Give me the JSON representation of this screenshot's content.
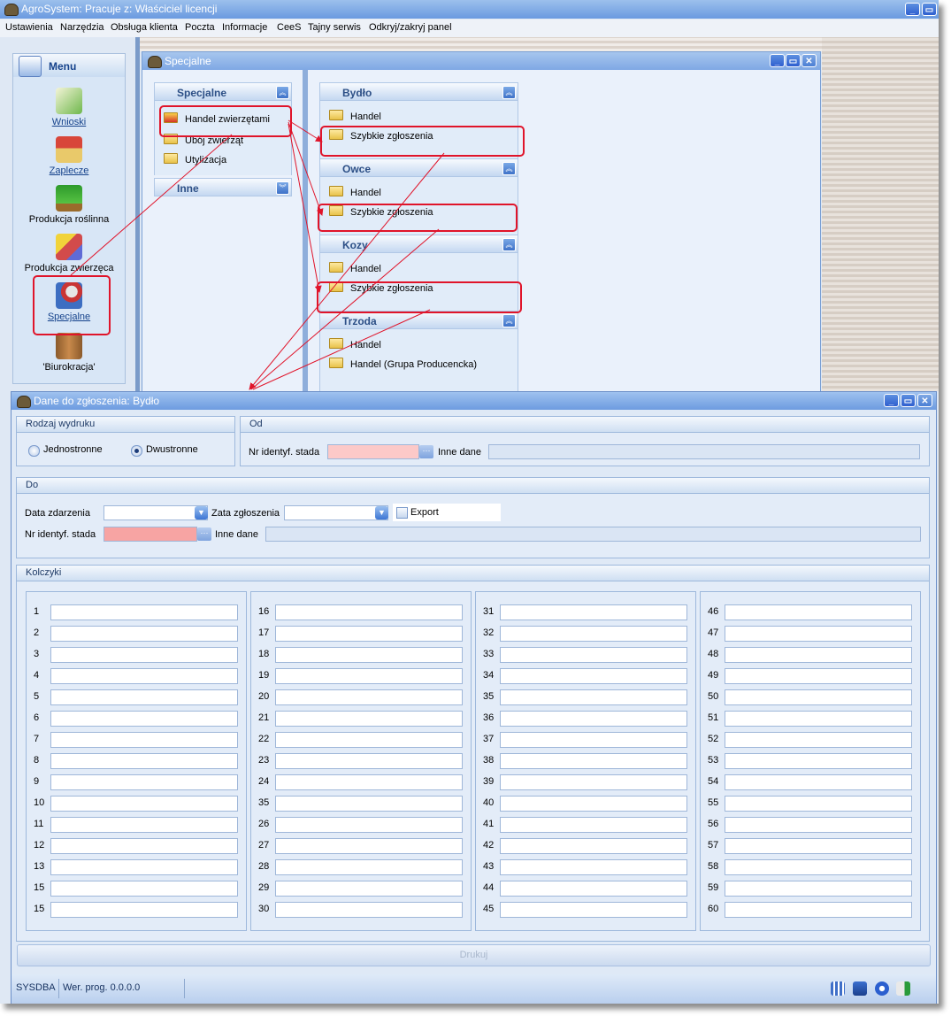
{
  "app": {
    "title": "AgroSystem: Pracuje z: Właściciel licencji",
    "window_buttons": [
      "_",
      "▭"
    ]
  },
  "menubar": [
    "Ustawienia",
    "Narzędzia",
    "Obsługa klienta",
    "Poczta",
    "Informacje",
    "CeeS",
    "Tajny serwis",
    "Odkryj/zakryj panel"
  ],
  "nav": {
    "header": "Menu",
    "items": [
      {
        "label": "Wnioski",
        "icon": "pen-form-icon"
      },
      {
        "label": "Zaplecze",
        "icon": "house-icon"
      },
      {
        "label": "Produkcja roślinna",
        "icon": "plant-icon"
      },
      {
        "label": "Produkcja zwierzęca",
        "icon": "cubes-icon"
      },
      {
        "label": "Specjalne",
        "icon": "special-icon"
      },
      {
        "label": "'Biurokracja'",
        "icon": "folders-icon"
      }
    ]
  },
  "specjalne_window": {
    "title": "Specjalne",
    "left_groups": [
      {
        "title": "Specjalne",
        "items": [
          "Handel zwierzętami",
          "Ubój zwierząt",
          "Utylizacja"
        ]
      },
      {
        "title": "Inne",
        "items": []
      }
    ],
    "right_groups": [
      {
        "title": "Bydło",
        "items": [
          "Handel",
          "Szybkie zgłoszenia"
        ]
      },
      {
        "title": "Owce",
        "items": [
          "Handel",
          "Szybkie zgłoszenia"
        ]
      },
      {
        "title": "Kozy",
        "items": [
          "Handel",
          "Szybkie zgłoszenia"
        ]
      },
      {
        "title": "Trzoda",
        "items": [
          "Handel",
          "Handel (Grupa Producencka)"
        ]
      }
    ]
  },
  "dialog": {
    "title": "Dane do zgłoszenia: Bydło",
    "rodzaj": {
      "header": "Rodzaj wydruku",
      "options": [
        "Jednostronne",
        "Dwustronne"
      ],
      "selected": "Dwustronne"
    },
    "od": {
      "header": "Od",
      "nr_label": "Nr identyf. stada",
      "nr_value": "",
      "inne_label": "Inne dane",
      "inne_value": ""
    },
    "do": {
      "header": "Do",
      "data_zdarzenia_label": "Data zdarzenia",
      "data_zdarzenia_value": "",
      "zata_label": "Zata zgłoszenia",
      "zata_value": "",
      "export_label": "Export",
      "nr_label": "Nr identyf. stada",
      "nr_value": "",
      "inne_label": "Inne dane",
      "inne_value": ""
    },
    "kolczyki": {
      "header": "Kolczyki",
      "columns": [
        [
          "1",
          "2",
          "3",
          "4",
          "5",
          "6",
          "7",
          "8",
          "9",
          "10",
          "11",
          "12",
          "13",
          "15",
          "15"
        ],
        [
          "16",
          "17",
          "18",
          "19",
          "20",
          "21",
          "22",
          "23",
          "24",
          "35",
          "26",
          "27",
          "28",
          "29",
          "30"
        ],
        [
          "31",
          "32",
          "33",
          "34",
          "35",
          "36",
          "37",
          "38",
          "39",
          "40",
          "41",
          "42",
          "43",
          "44",
          "45"
        ],
        [
          "46",
          "47",
          "48",
          "49",
          "50",
          "51",
          "52",
          "53",
          "54",
          "55",
          "56",
          "57",
          "58",
          "59",
          "60"
        ]
      ]
    },
    "print_button": "Drukuj",
    "status": {
      "user": "SYSDBA",
      "version": "Wer. prog. 0.0.0.0"
    }
  },
  "annotations": {
    "color": "#e0142a"
  }
}
